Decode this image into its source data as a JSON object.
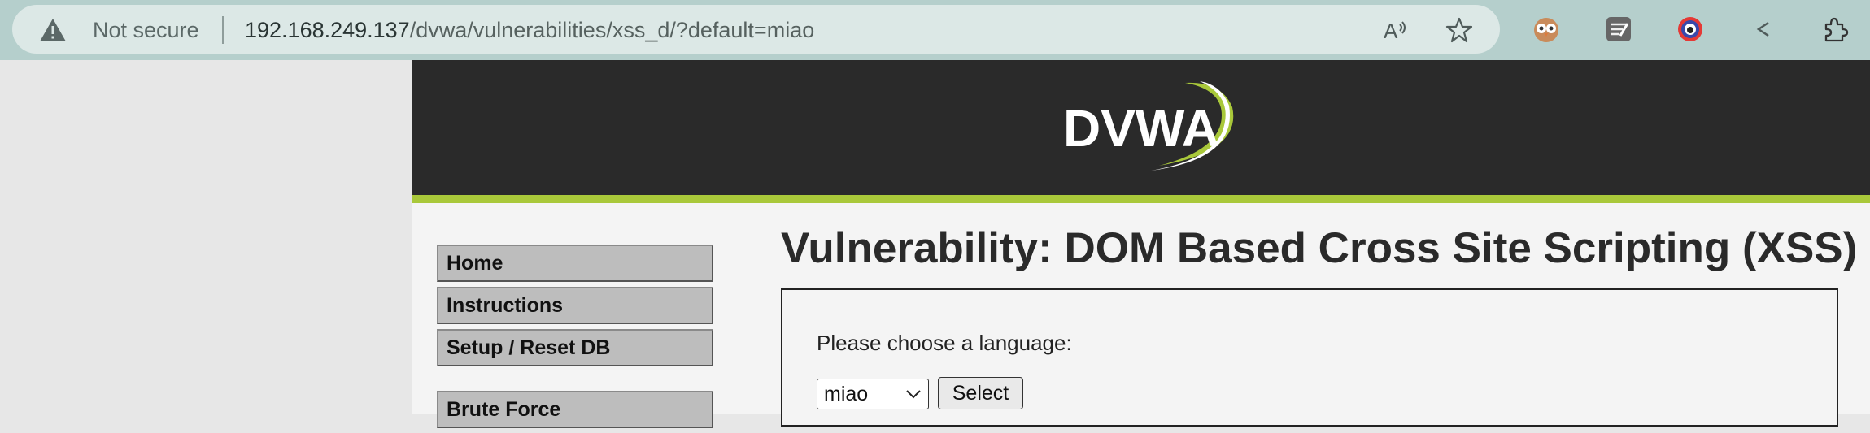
{
  "browser": {
    "security_label": "Not secure",
    "url_host": "192.168.249.137",
    "url_path": "/dvwa/vulnerabilities/xss_d/?default=miao",
    "icons": [
      "warning-icon",
      "read-aloud-icon",
      "favorite-star-icon",
      "extension-owl-icon",
      "extension-notes-icon",
      "extension-eye-icon",
      "extension-back-icon",
      "extensions-puzzle-icon"
    ]
  },
  "header": {
    "logo_text": "DVWA"
  },
  "menu": {
    "items": [
      "Home",
      "Instructions",
      "Setup / Reset DB",
      "Brute Force"
    ]
  },
  "main": {
    "title": "Vulnerability: DOM Based Cross Site Scripting (XSS)",
    "prompt": "Please choose a language:",
    "selected_language": "miao",
    "select_button": "Select"
  },
  "colors": {
    "banner": "#2a2a2a",
    "accent": "#a9c83a",
    "toolbar": "#b5cfcc"
  }
}
